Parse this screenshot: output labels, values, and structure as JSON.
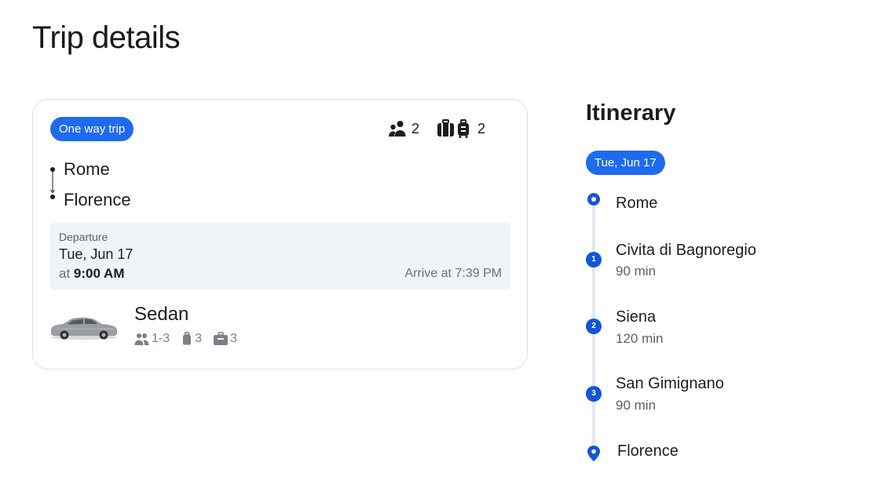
{
  "page": {
    "title": "Trip details"
  },
  "trip": {
    "type_label": "One way trip",
    "passengers": "2",
    "luggage": "2",
    "origin": "Rome",
    "destination": "Florence",
    "departure": {
      "label": "Departure",
      "date": "Tue, Jun 17",
      "at_label": "at",
      "time": "9:00 AM",
      "arrive": "Arrive at 7:39 PM"
    },
    "vehicle": {
      "name": "Sedan",
      "passengers": "1-3",
      "suitcases": "3",
      "carry_on": "3"
    }
  },
  "itinerary": {
    "title": "Itinerary",
    "date": "Tue, Jun 17",
    "stops": [
      {
        "marker": "",
        "name": "Rome",
        "duration": ""
      },
      {
        "marker": "1",
        "name": "Civita di Bagnoregio",
        "duration": "90 min"
      },
      {
        "marker": "2",
        "name": "Siena",
        "duration": "120 min"
      },
      {
        "marker": "3",
        "name": "San Gimignano",
        "duration": "90 min"
      },
      {
        "marker": "",
        "name": "Florence",
        "duration": ""
      }
    ]
  },
  "colors": {
    "accent": "#1f6bf0",
    "marker": "#1256d6",
    "panel": "#f0f3f7",
    "muted_text": "#6b7078"
  },
  "icons": [
    "passengers-icon",
    "luggage-icon",
    "car-image",
    "person-icon",
    "suitcase-icon",
    "carry-on-icon",
    "origin-marker-icon",
    "destination-pin-icon"
  ]
}
